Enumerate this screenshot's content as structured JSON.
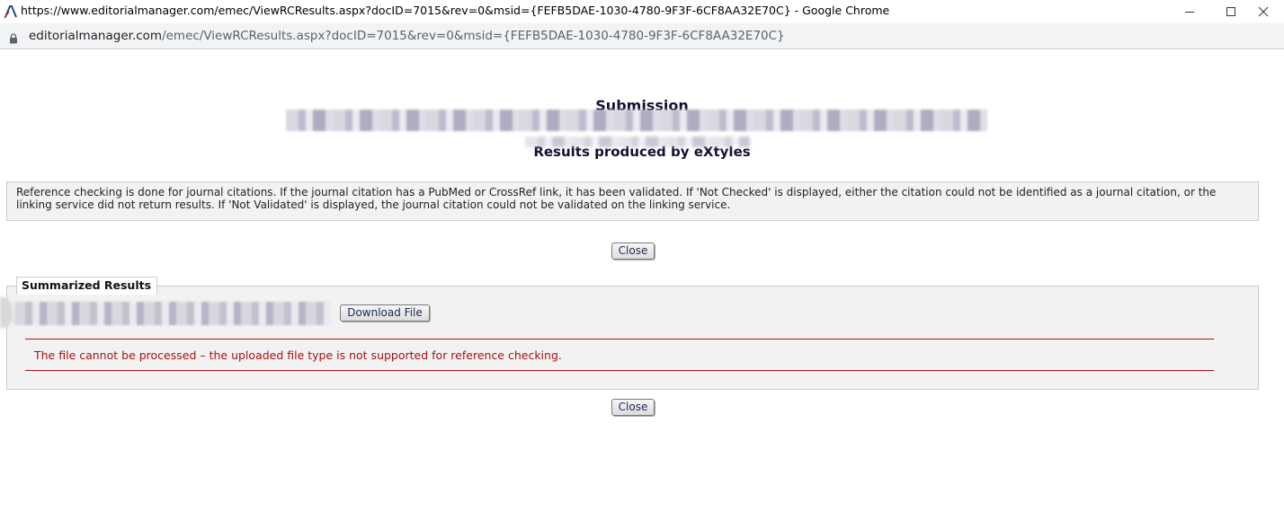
{
  "window": {
    "title": "https://www.editorialmanager.com/emec/ViewRCResults.aspx?docID=7015&rev=0&msid={FEFB5DAE-1030-4780-9F3F-6CF8AA32E70C} - Google Chrome",
    "icon": "editorial-manager-favicon"
  },
  "addressbar": {
    "host": "editorialmanager.com",
    "path": "/emec/ViewRCResults.aspx?docID=7015&rev=0&msid={FEFB5DAE-1030-4780-9F3F-6CF8AA32E70C}",
    "icon": "lock-icon"
  },
  "page": {
    "heading": "Submission",
    "results_heading": "Results produced by eXtyles",
    "info_text": "Reference checking is done for journal citations. If the journal citation has a PubMed or CrossRef link, it has been validated. If 'Not Checked' is displayed, either the citation could not be identified as a journal citation, or the linking service did not return results. If 'Not Validated' is displayed, the journal citation could not be validated on the linking service.",
    "close_label": "Close",
    "summary": {
      "legend": "Summarized Results",
      "download_label": "Download File",
      "error_message": "The file cannot be processed – the uploaded file type is not supported for reference checking."
    }
  },
  "colors": {
    "error": "#aa1111",
    "panel": "#f2f2f2",
    "border": "#cccccc"
  }
}
